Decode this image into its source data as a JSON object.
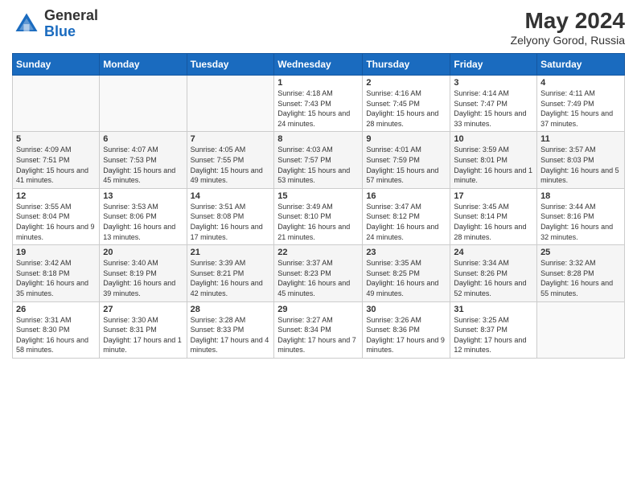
{
  "header": {
    "logo_general": "General",
    "logo_blue": "Blue",
    "title": "May 2024",
    "subtitle": "Zelyony Gorod, Russia"
  },
  "weekdays": [
    "Sunday",
    "Monday",
    "Tuesday",
    "Wednesday",
    "Thursday",
    "Friday",
    "Saturday"
  ],
  "weeks": [
    [
      {
        "day": "",
        "sunrise": "",
        "sunset": "",
        "daylight": ""
      },
      {
        "day": "",
        "sunrise": "",
        "sunset": "",
        "daylight": ""
      },
      {
        "day": "",
        "sunrise": "",
        "sunset": "",
        "daylight": ""
      },
      {
        "day": "1",
        "sunrise": "Sunrise: 4:18 AM",
        "sunset": "Sunset: 7:43 PM",
        "daylight": "Daylight: 15 hours and 24 minutes."
      },
      {
        "day": "2",
        "sunrise": "Sunrise: 4:16 AM",
        "sunset": "Sunset: 7:45 PM",
        "daylight": "Daylight: 15 hours and 28 minutes."
      },
      {
        "day": "3",
        "sunrise": "Sunrise: 4:14 AM",
        "sunset": "Sunset: 7:47 PM",
        "daylight": "Daylight: 15 hours and 33 minutes."
      },
      {
        "day": "4",
        "sunrise": "Sunrise: 4:11 AM",
        "sunset": "Sunset: 7:49 PM",
        "daylight": "Daylight: 15 hours and 37 minutes."
      }
    ],
    [
      {
        "day": "5",
        "sunrise": "Sunrise: 4:09 AM",
        "sunset": "Sunset: 7:51 PM",
        "daylight": "Daylight: 15 hours and 41 minutes."
      },
      {
        "day": "6",
        "sunrise": "Sunrise: 4:07 AM",
        "sunset": "Sunset: 7:53 PM",
        "daylight": "Daylight: 15 hours and 45 minutes."
      },
      {
        "day": "7",
        "sunrise": "Sunrise: 4:05 AM",
        "sunset": "Sunset: 7:55 PM",
        "daylight": "Daylight: 15 hours and 49 minutes."
      },
      {
        "day": "8",
        "sunrise": "Sunrise: 4:03 AM",
        "sunset": "Sunset: 7:57 PM",
        "daylight": "Daylight: 15 hours and 53 minutes."
      },
      {
        "day": "9",
        "sunrise": "Sunrise: 4:01 AM",
        "sunset": "Sunset: 7:59 PM",
        "daylight": "Daylight: 15 hours and 57 minutes."
      },
      {
        "day": "10",
        "sunrise": "Sunrise: 3:59 AM",
        "sunset": "Sunset: 8:01 PM",
        "daylight": "Daylight: 16 hours and 1 minute."
      },
      {
        "day": "11",
        "sunrise": "Sunrise: 3:57 AM",
        "sunset": "Sunset: 8:03 PM",
        "daylight": "Daylight: 16 hours and 5 minutes."
      }
    ],
    [
      {
        "day": "12",
        "sunrise": "Sunrise: 3:55 AM",
        "sunset": "Sunset: 8:04 PM",
        "daylight": "Daylight: 16 hours and 9 minutes."
      },
      {
        "day": "13",
        "sunrise": "Sunrise: 3:53 AM",
        "sunset": "Sunset: 8:06 PM",
        "daylight": "Daylight: 16 hours and 13 minutes."
      },
      {
        "day": "14",
        "sunrise": "Sunrise: 3:51 AM",
        "sunset": "Sunset: 8:08 PM",
        "daylight": "Daylight: 16 hours and 17 minutes."
      },
      {
        "day": "15",
        "sunrise": "Sunrise: 3:49 AM",
        "sunset": "Sunset: 8:10 PM",
        "daylight": "Daylight: 16 hours and 21 minutes."
      },
      {
        "day": "16",
        "sunrise": "Sunrise: 3:47 AM",
        "sunset": "Sunset: 8:12 PM",
        "daylight": "Daylight: 16 hours and 24 minutes."
      },
      {
        "day": "17",
        "sunrise": "Sunrise: 3:45 AM",
        "sunset": "Sunset: 8:14 PM",
        "daylight": "Daylight: 16 hours and 28 minutes."
      },
      {
        "day": "18",
        "sunrise": "Sunrise: 3:44 AM",
        "sunset": "Sunset: 8:16 PM",
        "daylight": "Daylight: 16 hours and 32 minutes."
      }
    ],
    [
      {
        "day": "19",
        "sunrise": "Sunrise: 3:42 AM",
        "sunset": "Sunset: 8:18 PM",
        "daylight": "Daylight: 16 hours and 35 minutes."
      },
      {
        "day": "20",
        "sunrise": "Sunrise: 3:40 AM",
        "sunset": "Sunset: 8:19 PM",
        "daylight": "Daylight: 16 hours and 39 minutes."
      },
      {
        "day": "21",
        "sunrise": "Sunrise: 3:39 AM",
        "sunset": "Sunset: 8:21 PM",
        "daylight": "Daylight: 16 hours and 42 minutes."
      },
      {
        "day": "22",
        "sunrise": "Sunrise: 3:37 AM",
        "sunset": "Sunset: 8:23 PM",
        "daylight": "Daylight: 16 hours and 45 minutes."
      },
      {
        "day": "23",
        "sunrise": "Sunrise: 3:35 AM",
        "sunset": "Sunset: 8:25 PM",
        "daylight": "Daylight: 16 hours and 49 minutes."
      },
      {
        "day": "24",
        "sunrise": "Sunrise: 3:34 AM",
        "sunset": "Sunset: 8:26 PM",
        "daylight": "Daylight: 16 hours and 52 minutes."
      },
      {
        "day": "25",
        "sunrise": "Sunrise: 3:32 AM",
        "sunset": "Sunset: 8:28 PM",
        "daylight": "Daylight: 16 hours and 55 minutes."
      }
    ],
    [
      {
        "day": "26",
        "sunrise": "Sunrise: 3:31 AM",
        "sunset": "Sunset: 8:30 PM",
        "daylight": "Daylight: 16 hours and 58 minutes."
      },
      {
        "day": "27",
        "sunrise": "Sunrise: 3:30 AM",
        "sunset": "Sunset: 8:31 PM",
        "daylight": "Daylight: 17 hours and 1 minute."
      },
      {
        "day": "28",
        "sunrise": "Sunrise: 3:28 AM",
        "sunset": "Sunset: 8:33 PM",
        "daylight": "Daylight: 17 hours and 4 minutes."
      },
      {
        "day": "29",
        "sunrise": "Sunrise: 3:27 AM",
        "sunset": "Sunset: 8:34 PM",
        "daylight": "Daylight: 17 hours and 7 minutes."
      },
      {
        "day": "30",
        "sunrise": "Sunrise: 3:26 AM",
        "sunset": "Sunset: 8:36 PM",
        "daylight": "Daylight: 17 hours and 9 minutes."
      },
      {
        "day": "31",
        "sunrise": "Sunrise: 3:25 AM",
        "sunset": "Sunset: 8:37 PM",
        "daylight": "Daylight: 17 hours and 12 minutes."
      },
      {
        "day": "",
        "sunrise": "",
        "sunset": "",
        "daylight": ""
      }
    ]
  ]
}
